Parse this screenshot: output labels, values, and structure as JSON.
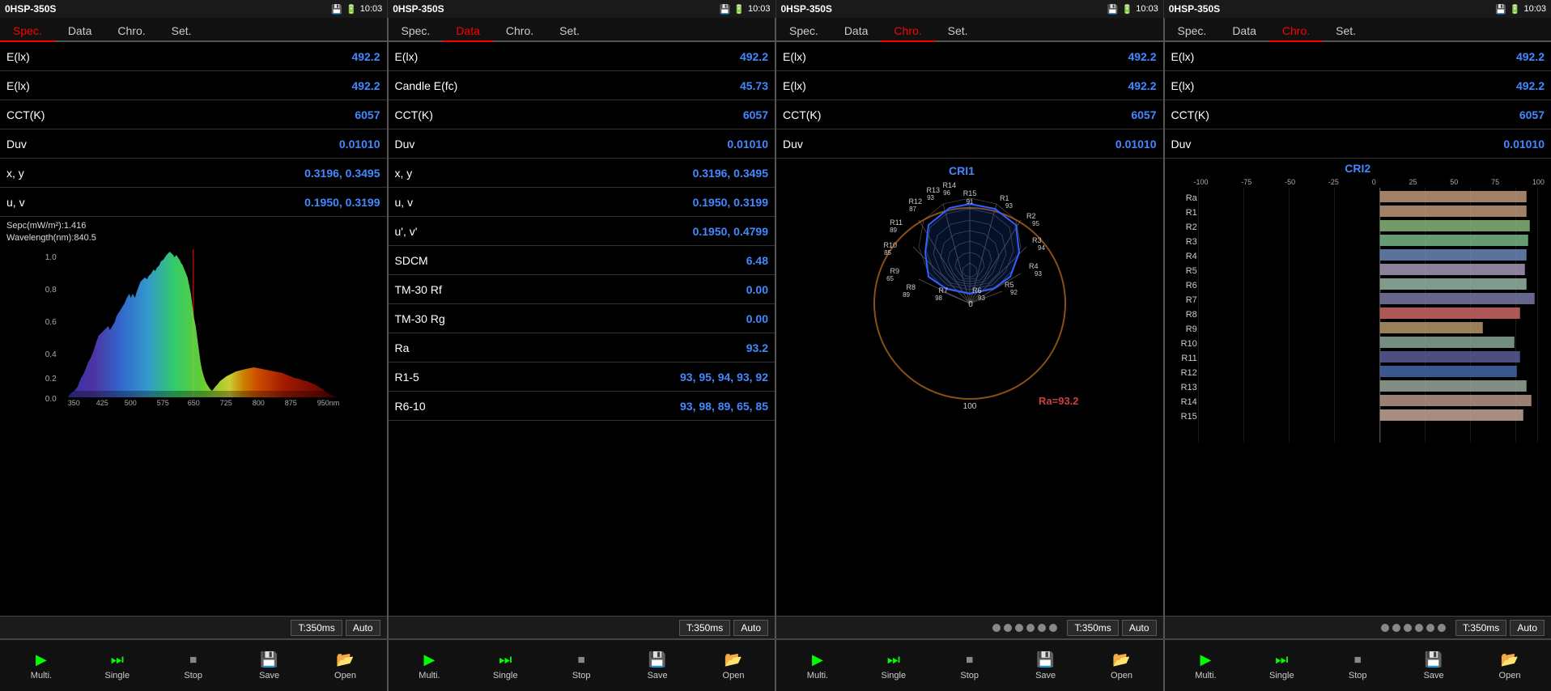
{
  "panels": [
    {
      "id": "panel1",
      "title": "0HSP-350S",
      "time": "10:03",
      "activeTab": "Spec.",
      "tabs": [
        "Spec.",
        "Data",
        "Chro.",
        "Set."
      ],
      "measurements": [
        {
          "label": "E(lx)",
          "value": "492.2"
        },
        {
          "label": "E(lx)",
          "value": "492.2"
        },
        {
          "label": "CCT(K)",
          "value": "6057"
        },
        {
          "label": "Duv",
          "value": "0.01010"
        },
        {
          "label": "x, y",
          "value": "0.3196, 0.3495"
        },
        {
          "label": "u, v",
          "value": "0.1950, 0.3199"
        }
      ],
      "specInfo": {
        "sepc": "Sepc(mW/m²):1.416",
        "wavelength": "Wavelength(nm):840.5"
      },
      "timing": "T:350ms",
      "timingMode": "Auto",
      "hasDots": false
    },
    {
      "id": "panel2",
      "title": "0HSP-350S",
      "time": "10:03",
      "activeTab": "Data",
      "tabs": [
        "Spec.",
        "Data",
        "Chro.",
        "Set."
      ],
      "measurements": [
        {
          "label": "E(lx)",
          "value": "492.2"
        },
        {
          "label": "Candle E(fc)",
          "value": "45.73"
        },
        {
          "label": "CCT(K)",
          "value": "6057"
        },
        {
          "label": "Duv",
          "value": "0.01010"
        },
        {
          "label": "x, y",
          "value": "0.3196, 0.3495"
        },
        {
          "label": "u, v",
          "value": "0.1950, 0.3199"
        },
        {
          "label": "u', v'",
          "value": "0.1950, 0.4799"
        },
        {
          "label": "SDCM",
          "value": "6.48"
        },
        {
          "label": "TM-30 Rf",
          "value": "0.00"
        },
        {
          "label": "TM-30 Rg",
          "value": "0.00"
        },
        {
          "label": "Ra",
          "value": "93.2"
        },
        {
          "label": "R1-5",
          "value": "93, 95, 94, 93, 92"
        },
        {
          "label": "R6-10",
          "value": "93, 98, 89, 65, 85"
        }
      ],
      "timing": "T:350ms",
      "timingMode": "Auto",
      "hasDots": false
    },
    {
      "id": "panel3",
      "title": "0HSP-350S",
      "time": "10:03",
      "activeTab": "Chro.",
      "tabs": [
        "Spec.",
        "Data",
        "Chro.",
        "Set."
      ],
      "measurements": [
        {
          "label": "E(lx)",
          "value": "492.2"
        },
        {
          "label": "E(lx)",
          "value": "492.2"
        },
        {
          "label": "CCT(K)",
          "value": "6057"
        },
        {
          "label": "Duv",
          "value": "0.01010"
        }
      ],
      "raLabels": [
        "R15\n91",
        "R1\n93",
        "R2\n95",
        "R3\n94",
        "R4\n93",
        "R5\n92",
        "R6\n93",
        "R7\n98",
        "R8\n89",
        "R9\n65",
        "R10\n85",
        "R11\n89",
        "R12\n87",
        "R13\n93",
        "R14\n96"
      ],
      "raValue": "Ra=93.2",
      "criTitle": "CRI1",
      "timing": "T:350ms",
      "timingMode": "Auto",
      "hasDots": true,
      "dotCount": 6
    },
    {
      "id": "panel4",
      "title": "0HSP-350S",
      "time": "10:03",
      "activeTab": "Chro.",
      "tabs": [
        "Spec.",
        "Data",
        "Chro.",
        "Set."
      ],
      "measurements": [
        {
          "label": "E(lx)",
          "value": "492.2"
        },
        {
          "label": "E(lx)",
          "value": "492.2"
        },
        {
          "label": "CCT(K)",
          "value": "6057"
        },
        {
          "label": "Duv",
          "value": "0.01010"
        }
      ],
      "criTitle": "CRI2",
      "criBarLabels": [
        "Ra",
        "R1",
        "R2",
        "R3",
        "R4",
        "R5",
        "R6",
        "R7",
        "R8",
        "R9",
        "R10",
        "R11",
        "R12",
        "R13",
        "R14",
        "R15"
      ],
      "criBarValues": [
        93,
        93,
        95,
        94,
        93,
        92,
        93,
        98,
        89,
        65,
        85,
        89,
        87,
        93,
        96,
        91
      ],
      "criBarColors": [
        "#c8a080",
        "#c8a080",
        "#90b080",
        "#80b090",
        "#7090b0",
        "#b0a0c0",
        "#a0c0b0",
        "#8080b0",
        "#c06060",
        "#c0a070",
        "#90b0a0",
        "#6060a0",
        "#4060a0",
        "#a0b0a0",
        "#c0a090",
        "#d0b0a0"
      ],
      "timing": "T:350ms",
      "timingMode": "Auto",
      "hasDots": true,
      "dotCount": 6
    }
  ],
  "toolbar": {
    "buttons": [
      "Multi.",
      "Single",
      "Stop",
      "Save",
      "Open"
    ]
  }
}
